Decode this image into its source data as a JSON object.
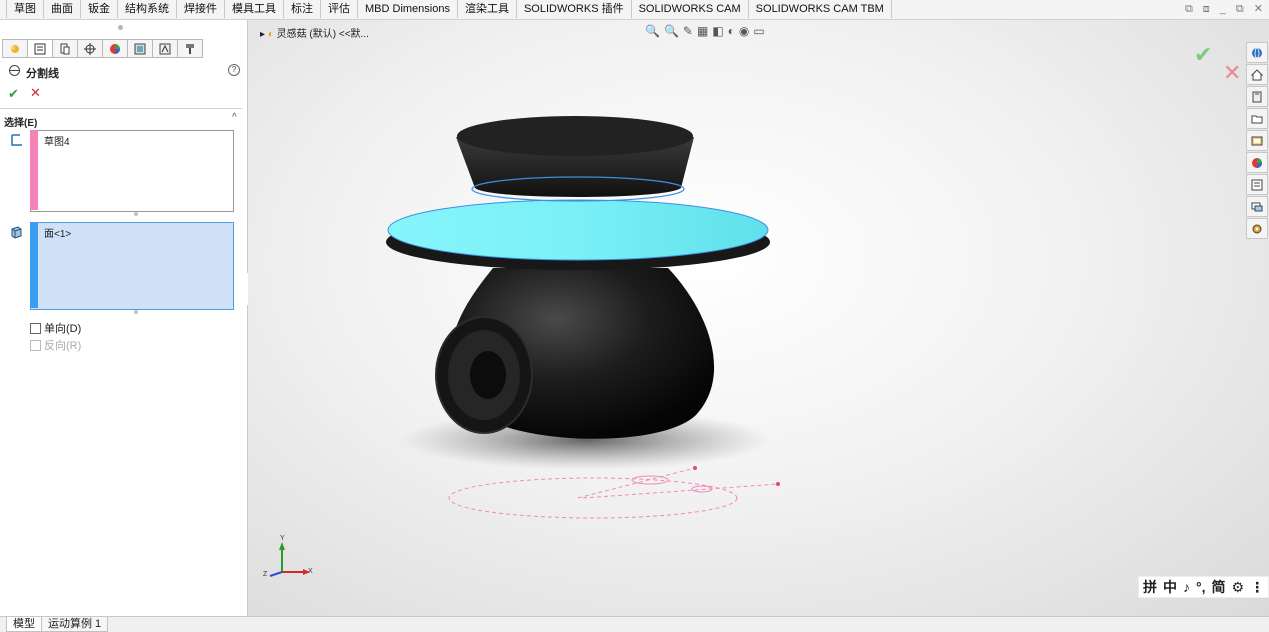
{
  "command_tabs": [
    "草图",
    "曲面",
    "钣金",
    "结构系统",
    "焊接件",
    "模具工具",
    "标注",
    "评估",
    "MBD Dimensions",
    "渲染工具",
    "SOLIDWORKS 插件",
    "SOLIDWORKS CAM",
    "SOLIDWORKS CAM TBM"
  ],
  "window_controls": [
    "⧉",
    "⧈",
    "_",
    "⧉",
    "✕"
  ],
  "property_manager": {
    "title": "分割线",
    "help": "?",
    "ok": "✔",
    "cancel": "✕",
    "selection_section": "选择(E)",
    "collapse": "^",
    "sketch_box_item": "草图4",
    "face_box_item": "面<1>",
    "single_direction": "单向(D)",
    "reverse_direction": "反向(R)"
  },
  "feature_tree_label": "灵感菇 (默认) <<默...",
  "viewport_icons": [
    "🔍",
    "🔍",
    "✎",
    "▦",
    "◧",
    "◐",
    "◉",
    "▭"
  ],
  "ime_bar": [
    "拼",
    "中",
    "♪",
    "°,",
    "简",
    "⚙",
    "⋮"
  ],
  "triad": {
    "x": "X",
    "y": "Y",
    "z": "Z"
  },
  "bottom_tabs": [
    "模型",
    "运动算例 1"
  ],
  "colors": {
    "sketch_bar": "#f484b8",
    "face_bar": "#3e9cf0",
    "highlight_face": "#7ff3f8"
  }
}
